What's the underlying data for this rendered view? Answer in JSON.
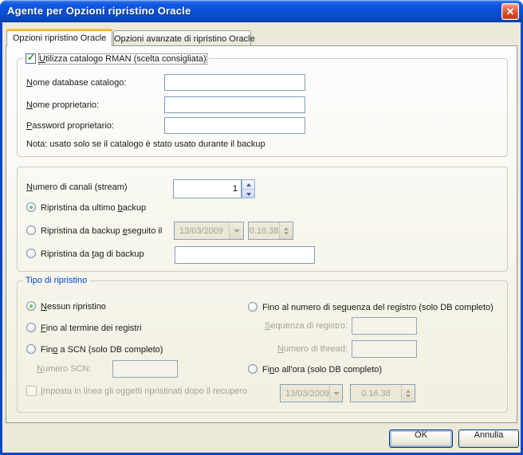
{
  "colors": {
    "titlebar_blue": "#0b50da",
    "window_frame_blue": "#0d47c8",
    "dialog_face": "#ece9d8",
    "tab_accent_orange": "#eda019",
    "checkmark_green": "#21a121",
    "radio_dot_green": "#3faf49",
    "groupbox_title_blue": "#0046d5",
    "edit_border_blue": "#7f9db9",
    "disabled_text": "#a5a294"
  },
  "window": {
    "title": "Agente per Opzioni ripristino Oracle",
    "close_glyph": "✕"
  },
  "tabs": {
    "active": "Opzioni ripristino Oracle",
    "inactive": "Opzioni avanzate di ripristino Oracle"
  },
  "catalog_group": {
    "checkbox": {
      "label": {
        "pre": "",
        "key": "U",
        "post": "tilizza catalogo RMAN (scelta consigliata)"
      },
      "checked": true
    },
    "check_glyph": "✓",
    "fields": [
      {
        "label": {
          "pre": "",
          "key": "N",
          "post": "ome database catalogo:"
        },
        "value": ""
      },
      {
        "label": {
          "pre": "",
          "key": "N",
          "post": "ome proprietario:"
        },
        "value": ""
      },
      {
        "label": {
          "pre": "",
          "key": "P",
          "post": "assword proprietario:"
        },
        "value": ""
      }
    ],
    "note": "Nota: usato solo se il catalogo è stato usato durante il backup"
  },
  "channels": {
    "label": {
      "pre": "",
      "key": "N",
      "post": "umero di canali (stream)"
    },
    "value": "1"
  },
  "restore_options": {
    "latest": {
      "label": {
        "pre": "Ripristina da ultimo ",
        "key": "b",
        "post": "ackup"
      },
      "selected": true
    },
    "by_date": {
      "label": {
        "pre": "Ripristina da backup ",
        "key": "e",
        "post": "seguito il"
      },
      "selected": false,
      "date": "13/03/2009",
      "time": "0.16.38"
    },
    "by_tag": {
      "label": {
        "pre": "Ripristina da ",
        "key": "t",
        "post": "ag di backup"
      },
      "selected": false,
      "value": ""
    }
  },
  "recovery_group": {
    "title": "Tipo di ripristino",
    "none": {
      "label": {
        "pre": "",
        "key": "N",
        "post": "essun ripristino"
      },
      "selected": true
    },
    "end_of_logs": {
      "label": {
        "pre": "",
        "key": "F",
        "post": "ino al termine dei registri"
      },
      "selected": false
    },
    "to_scn": {
      "label": {
        "pre": "Fin",
        "key": "o",
        "post": " a SCN (solo DB completo)"
      },
      "selected": false
    },
    "scn": {
      "label": {
        "pre": "",
        "key": "N",
        "post": "umero SCN:"
      },
      "value": ""
    },
    "set_online": {
      "label": {
        "pre": "",
        "key": "I",
        "post": "mposta in linea gli oggetti ripristinati dopo il recupero"
      },
      "checked": false
    },
    "to_log_sequence": {
      "label": {
        "pre": "Fino al numero di se",
        "key": "q",
        "post": "uenza del registro (solo DB completo)"
      },
      "selected": false
    },
    "sequence": {
      "label": {
        "pre": "",
        "key": "S",
        "post": "equenza di registro:"
      },
      "value": ""
    },
    "thread": {
      "label": {
        "pre": "",
        "key": "N",
        "post": "umero di thread:"
      },
      "value": ""
    },
    "to_time": {
      "label": {
        "pre": "Fi",
        "key": "n",
        "post": "o all'ora (solo DB completo)"
      },
      "selected": false,
      "date": "13/03/2009",
      "time": "0.16.38"
    }
  },
  "buttons": {
    "ok": "OK",
    "cancel": "Annulla"
  }
}
